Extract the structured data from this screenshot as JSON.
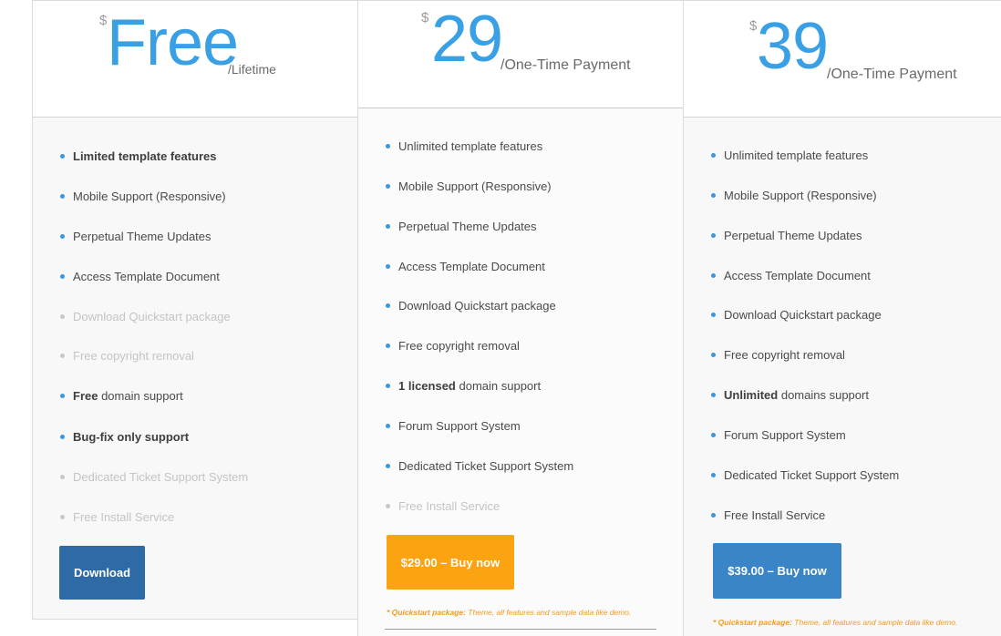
{
  "plans": [
    {
      "currency": "$",
      "price": "Free",
      "period": "/Lifetime",
      "features": [
        {
          "bold": "Limited template features",
          "rest": "",
          "disabled": false
        },
        {
          "bold": "",
          "rest": "Mobile Support (Responsive)",
          "disabled": false
        },
        {
          "bold": "",
          "rest": "Perpetual Theme Updates",
          "disabled": false
        },
        {
          "bold": "",
          "rest": "Access Template Document",
          "disabled": false
        },
        {
          "bold": "",
          "rest": "Download Quickstart package",
          "disabled": true
        },
        {
          "bold": "",
          "rest": "Free copyright removal",
          "disabled": true
        },
        {
          "bold": "Free",
          "rest": " domain support",
          "disabled": false
        },
        {
          "bold": "Bug-fix only support",
          "rest": "",
          "disabled": false
        },
        {
          "bold": "",
          "rest": "Dedicated Ticket Support System",
          "disabled": true
        },
        {
          "bold": "",
          "rest": "Free Install Service",
          "disabled": true
        }
      ],
      "button": "Download",
      "note_bold": "",
      "note_rest": ""
    },
    {
      "currency": "$",
      "price": "29",
      "period": "/One-Time Payment",
      "features": [
        {
          "bold": "",
          "rest": "Unlimited template features",
          "disabled": false
        },
        {
          "bold": "",
          "rest": "Mobile Support (Responsive)",
          "disabled": false
        },
        {
          "bold": "",
          "rest": "Perpetual Theme Updates",
          "disabled": false
        },
        {
          "bold": "",
          "rest": "Access Template Document",
          "disabled": false
        },
        {
          "bold": "",
          "rest": "Download Quickstart package",
          "disabled": false
        },
        {
          "bold": "",
          "rest": "Free copyright removal",
          "disabled": false
        },
        {
          "bold": "1 licensed",
          "rest": " domain support",
          "disabled": false
        },
        {
          "bold": "",
          "rest": "Forum Support System",
          "disabled": false
        },
        {
          "bold": "",
          "rest": "Dedicated Ticket Support System",
          "disabled": false
        },
        {
          "bold": "",
          "rest": "Free Install Service",
          "disabled": true
        }
      ],
      "button": "$29.00 – Buy now",
      "note_bold": "* Quickstart package:",
      "note_rest": " Theme, all features and sample data like demo."
    },
    {
      "currency": "$",
      "price": "39",
      "period": "/One-Time Payment",
      "features": [
        {
          "bold": "",
          "rest": "Unlimited template features",
          "disabled": false
        },
        {
          "bold": "",
          "rest": "Mobile Support (Responsive)",
          "disabled": false
        },
        {
          "bold": "",
          "rest": "Perpetual Theme Updates",
          "disabled": false
        },
        {
          "bold": "",
          "rest": "Access Template Document",
          "disabled": false
        },
        {
          "bold": "",
          "rest": "Download Quickstart package",
          "disabled": false
        },
        {
          "bold": "",
          "rest": "Free copyright removal",
          "disabled": false
        },
        {
          "bold": "Unlimited",
          "rest": " domains support",
          "disabled": false
        },
        {
          "bold": "",
          "rest": "Forum Support System",
          "disabled": false
        },
        {
          "bold": "",
          "rest": "Dedicated Ticket Support System",
          "disabled": false
        },
        {
          "bold": "",
          "rest": "Free Install Service",
          "disabled": false
        }
      ],
      "button": "$39.00 – Buy now",
      "note_bold": "* Quickstart package:",
      "note_rest": " Theme, all features and sample data like demo."
    }
  ],
  "colors": {
    "price_blue": "#3aa0e6",
    "bullet_blue": "#3a96dd",
    "download_button": "#2e6aa6",
    "buy_29_button": "#fca311",
    "buy_39_button": "#3a84c8",
    "note_orange": "#f39b1b",
    "disabled_text": "#c4c4c4"
  }
}
